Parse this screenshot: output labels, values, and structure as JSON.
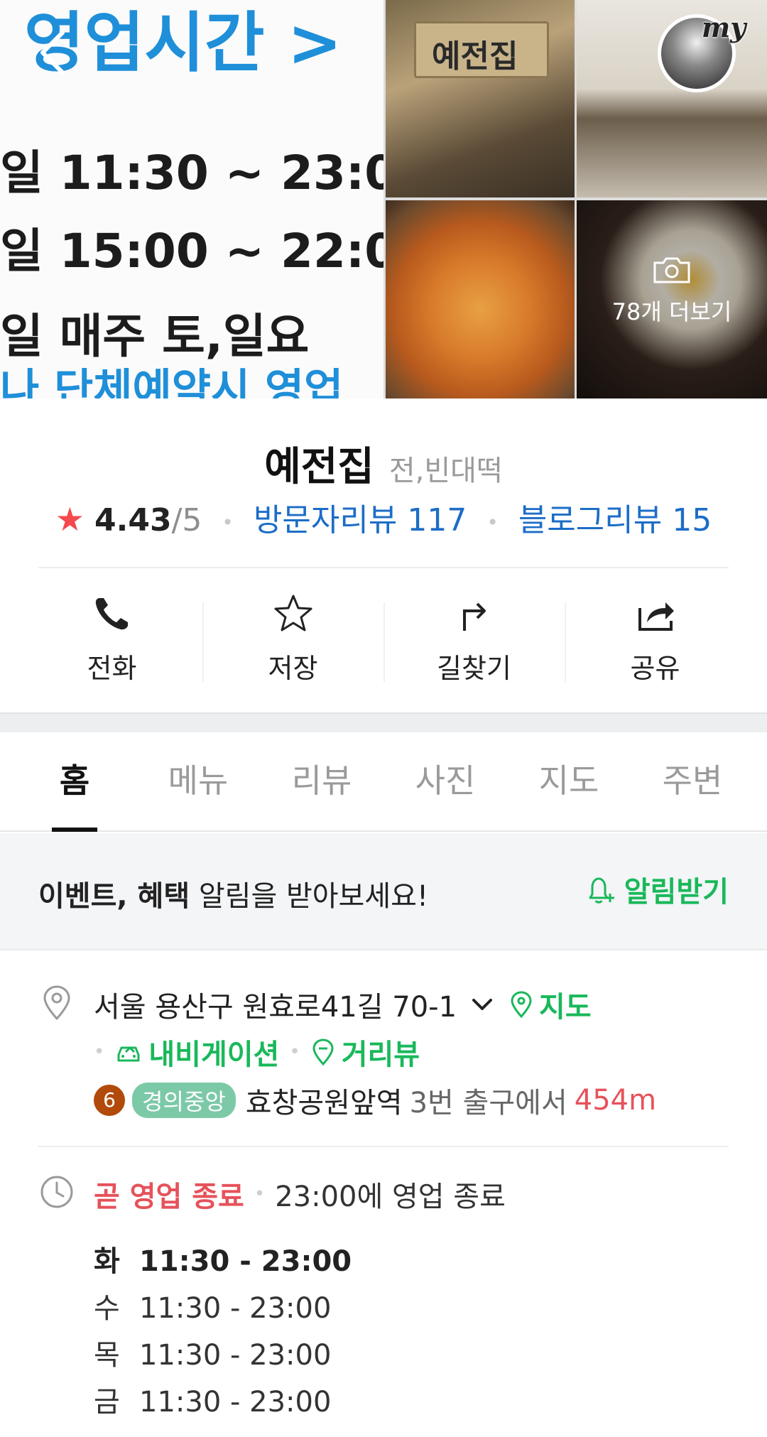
{
  "gallery": {
    "sign_title": "영업시간 >",
    "sign_row1": "일   11:30 ~ 23:0",
    "sign_row2": "일   15:00 ~ 22:0",
    "sign_row3": "일   매주  토,일요",
    "sign_row4": "나 단체예약시 영업",
    "store_sign": "예전집",
    "more_photos": "78개 더보기",
    "my_label": "my"
  },
  "place": {
    "name": "예전집",
    "category": "전,빈대떡",
    "rating": "4.43",
    "rating_max": "/5",
    "visitor_reviews": "방문자리뷰 117",
    "blog_reviews": "블로그리뷰 15"
  },
  "actions": [
    {
      "label": "전화",
      "icon": "phone-icon"
    },
    {
      "label": "저장",
      "icon": "star-icon"
    },
    {
      "label": "길찾기",
      "icon": "directions-icon"
    },
    {
      "label": "공유",
      "icon": "share-icon"
    }
  ],
  "tabs": [
    {
      "label": "홈",
      "active": true
    },
    {
      "label": "메뉴"
    },
    {
      "label": "리뷰"
    },
    {
      "label": "사진"
    },
    {
      "label": "지도"
    },
    {
      "label": "주변"
    }
  ],
  "notify": {
    "bold_text": "이벤트, 혜택",
    "text": " 알림을 받아보세요!",
    "button": "알림받기"
  },
  "address": {
    "text": "서울 용산구 원효로41길 70-1",
    "map_link": "지도",
    "navigation_link": "내비게이션",
    "street_view_link": "거리뷰"
  },
  "subway": {
    "line_number": "6",
    "line_name": "경의중앙",
    "station": "효창공원앞역",
    "exit": "3번 출구에서",
    "distance": "454m"
  },
  "hours": {
    "status": "곧 영업 종료",
    "status_detail": "23:00에 영업 종료",
    "rows": [
      {
        "day": "화",
        "time": "11:30 - 23:00"
      },
      {
        "day": "수",
        "time": "11:30 - 23:00"
      },
      {
        "day": "목",
        "time": "11:30 - 23:00"
      },
      {
        "day": "금",
        "time": "11:30 - 23:00"
      }
    ]
  },
  "colors": {
    "accent_green": "#19b85a",
    "link_blue": "#1c6dc7",
    "alert_red": "#e6525a",
    "star_red": "#f5494d"
  }
}
